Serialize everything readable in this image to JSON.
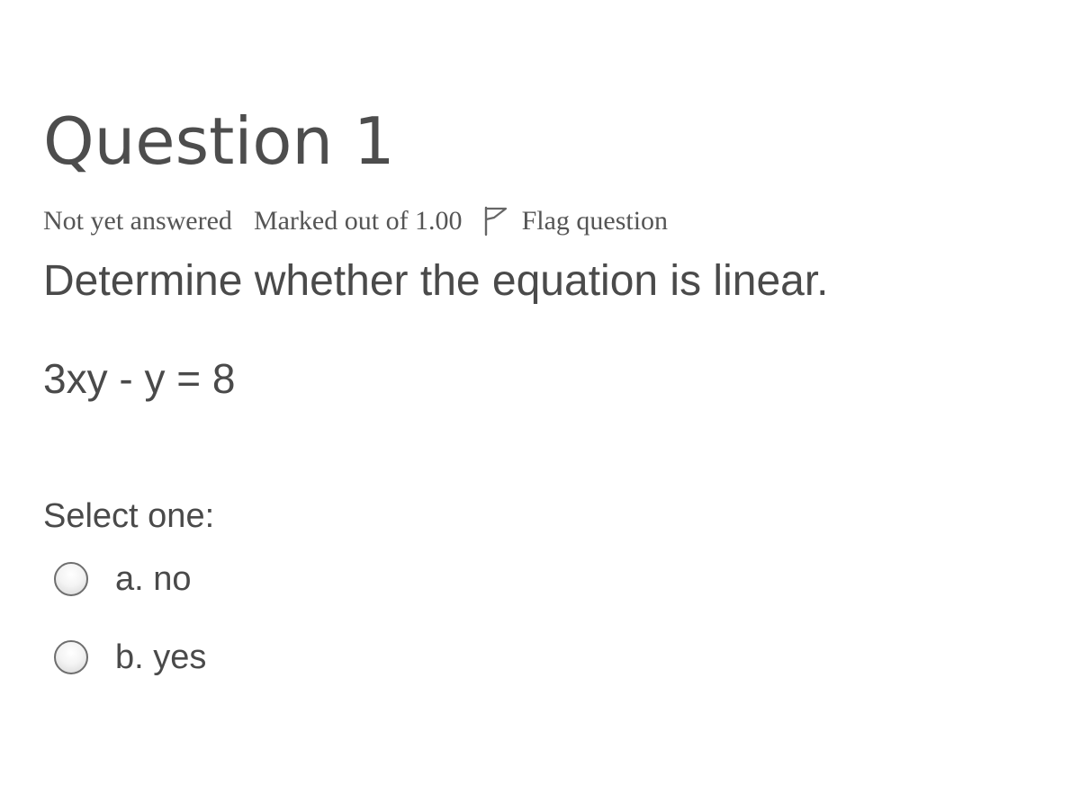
{
  "question": {
    "title": "Question 1",
    "state": "Not yet answered",
    "grade": "Marked out of 1.00",
    "flag_label": "Flag question",
    "text": "Determine whether the equation is linear.",
    "equation": "3xy - y = 8"
  },
  "answers": {
    "prompt": "Select one:",
    "options": [
      {
        "label": "a. no",
        "selected": false
      },
      {
        "label": "b. yes",
        "selected": false
      }
    ]
  },
  "icons": {
    "flag": "flag-outline-icon"
  },
  "colors": {
    "text": "#4a4a4a",
    "meta": "#555555",
    "radio_border": "#6e6e6e",
    "background": "#ffffff"
  }
}
